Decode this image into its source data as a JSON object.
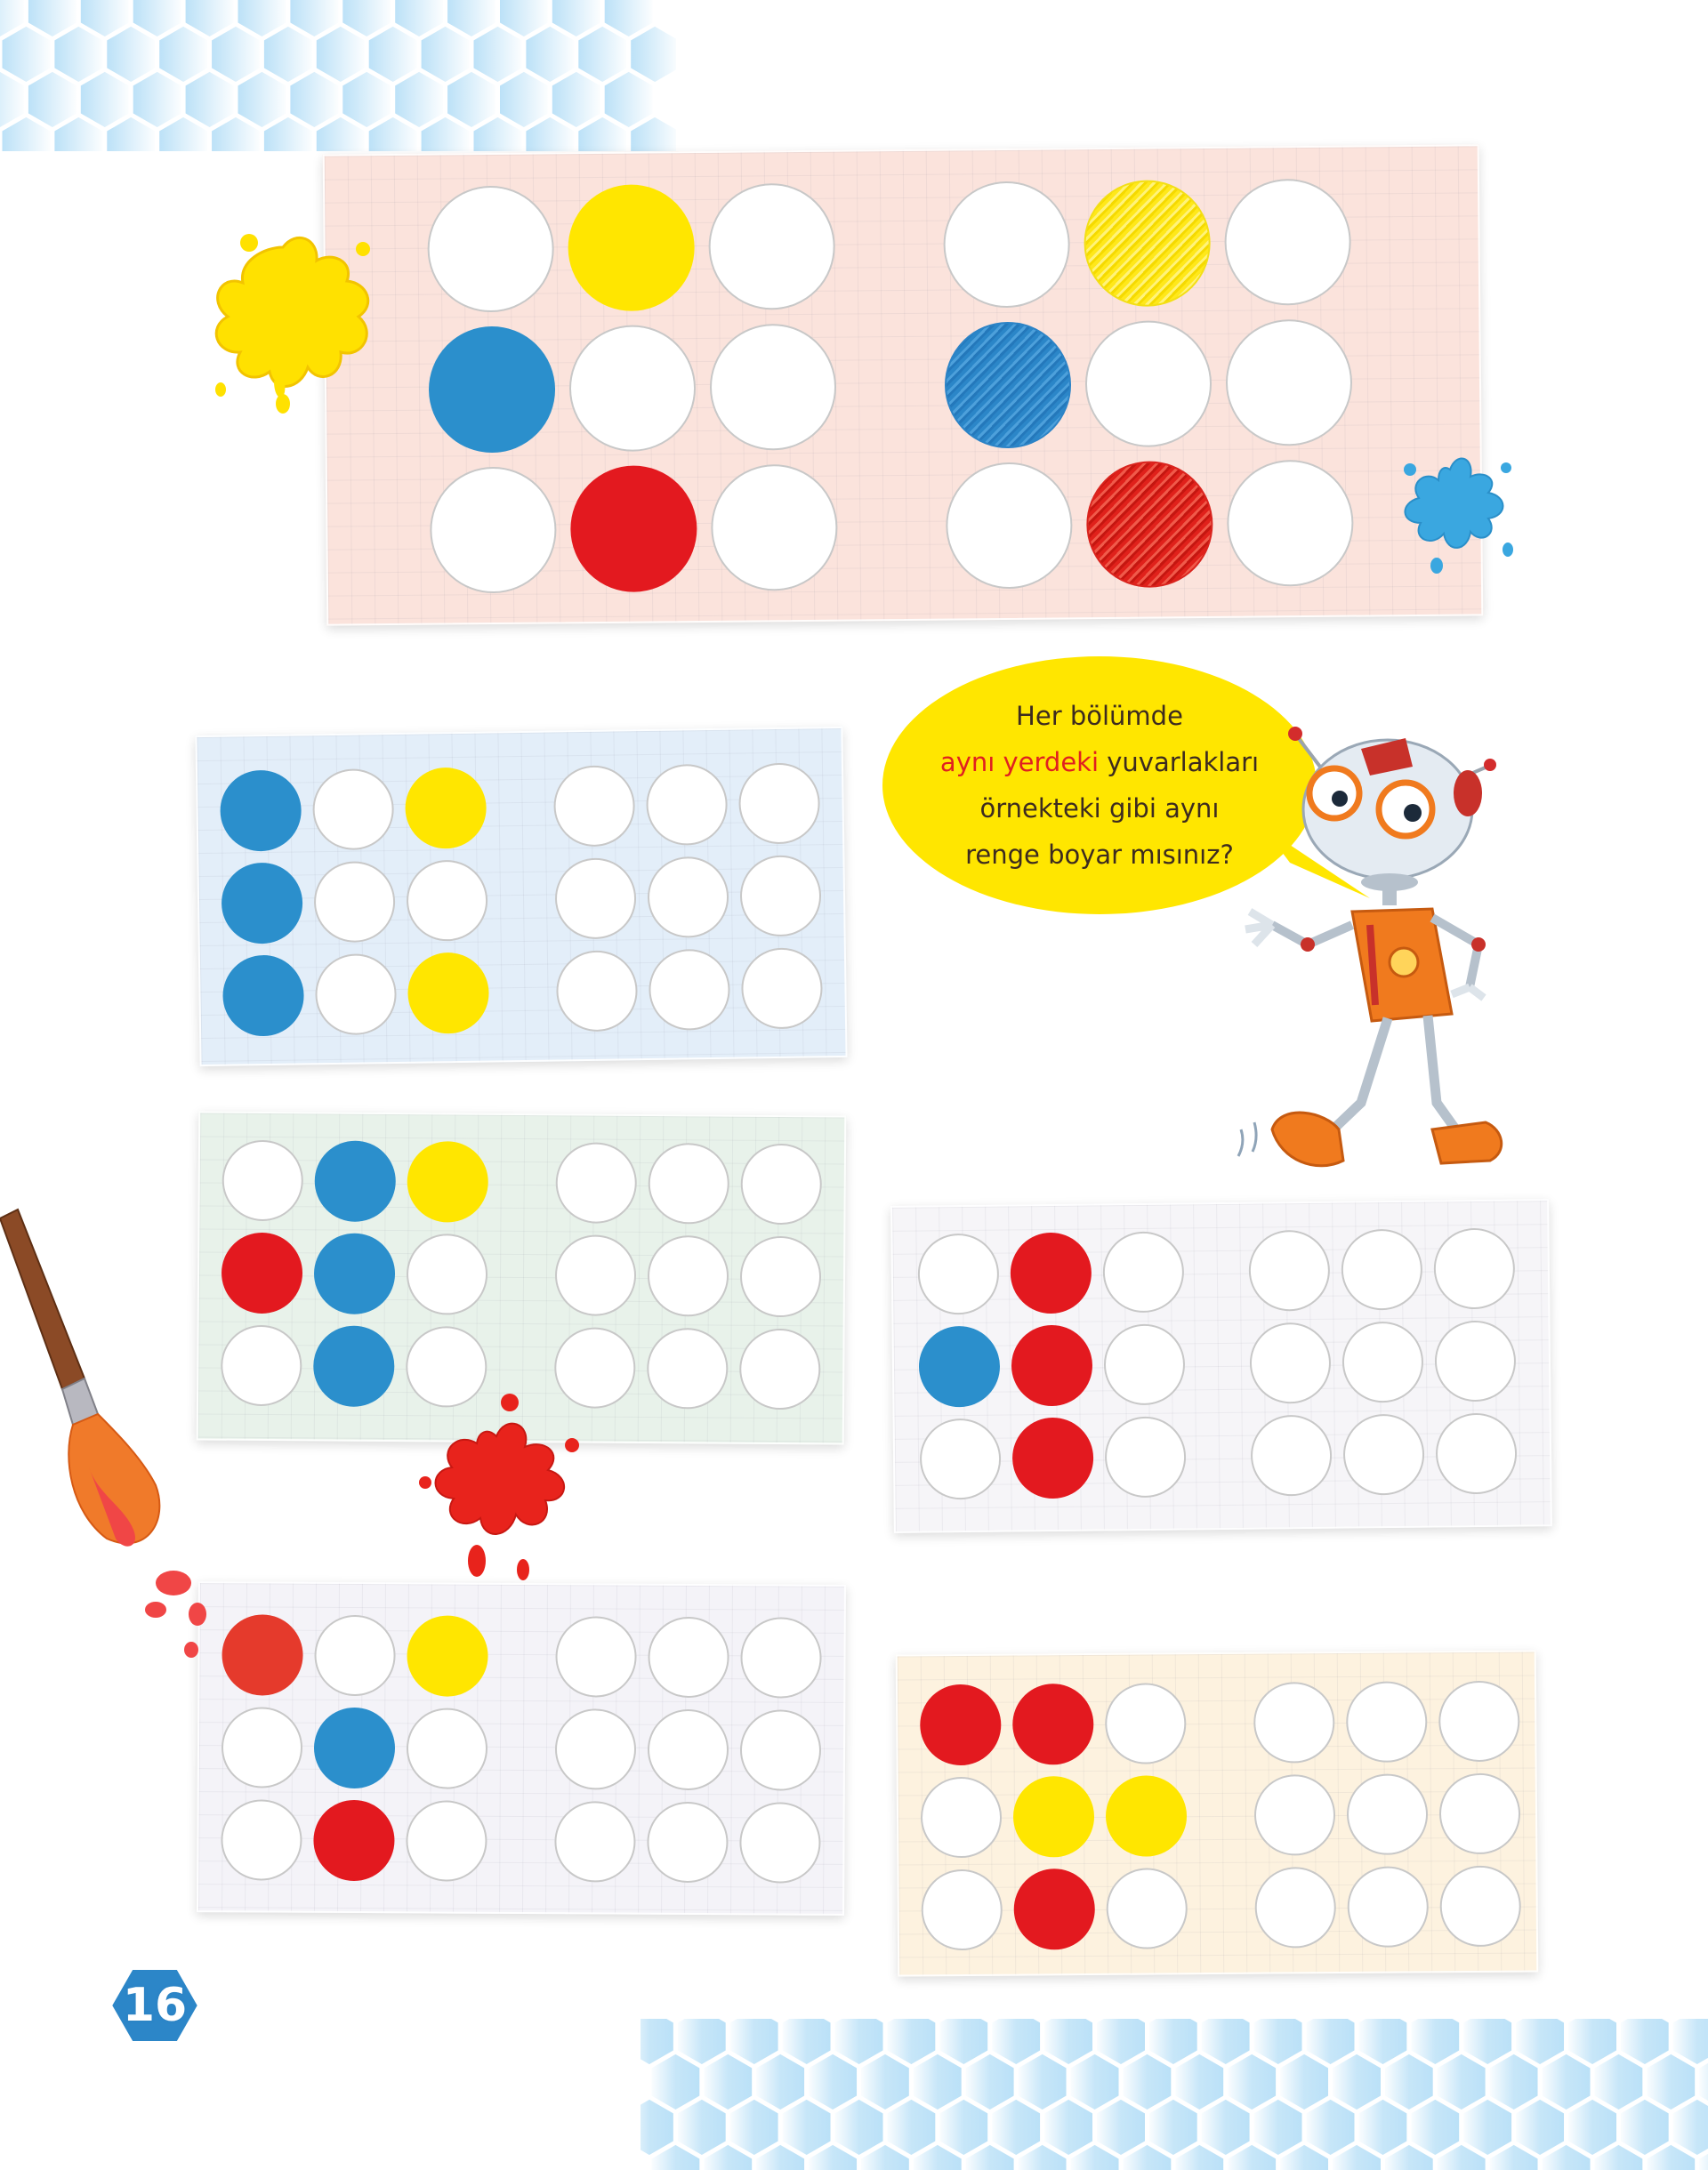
{
  "speech_bubble": {
    "line1": "Her bölümde",
    "line2_highlight": "aynı yerdeki",
    "line2_rest": " yuvarlakları",
    "line3": "örnekteki gibi aynı",
    "line4": "renge boyar mısınız?"
  },
  "page_number": "16",
  "example": {
    "left": [
      "white",
      "yellow",
      "white",
      "blue",
      "white",
      "white",
      "white",
      "red",
      "white"
    ],
    "right": [
      "white",
      "crayon-yellow",
      "white",
      "crayon-blue",
      "white",
      "white",
      "white",
      "crayon-red",
      "white"
    ]
  },
  "exercises": [
    {
      "id": "blue-card",
      "pattern": [
        "blue",
        "white",
        "yellow",
        "blue",
        "white",
        "white",
        "blue",
        "white",
        "yellow"
      ]
    },
    {
      "id": "green-card",
      "pattern": [
        "white",
        "blue",
        "yellow",
        "red",
        "blue",
        "white",
        "white",
        "blue",
        "white"
      ]
    },
    {
      "id": "grey-card",
      "pattern": [
        "white",
        "red",
        "white",
        "blue",
        "red",
        "white",
        "white",
        "red",
        "white"
      ]
    },
    {
      "id": "lilac-card",
      "pattern": [
        "red2",
        "white",
        "yellow",
        "white",
        "blue",
        "white",
        "white",
        "red",
        "white"
      ]
    },
    {
      "id": "cream-card",
      "pattern": [
        "red",
        "red",
        "white",
        "white",
        "yellow",
        "yellow",
        "white",
        "red",
        "white"
      ]
    }
  ],
  "colors": {
    "blue": "#2b8fcc",
    "yellow": "#ffe600",
    "red": "#e3191f",
    "bubble": "#ffe600",
    "highlight_text": "#e02020",
    "hex_pattern": "#bfe3f8"
  }
}
